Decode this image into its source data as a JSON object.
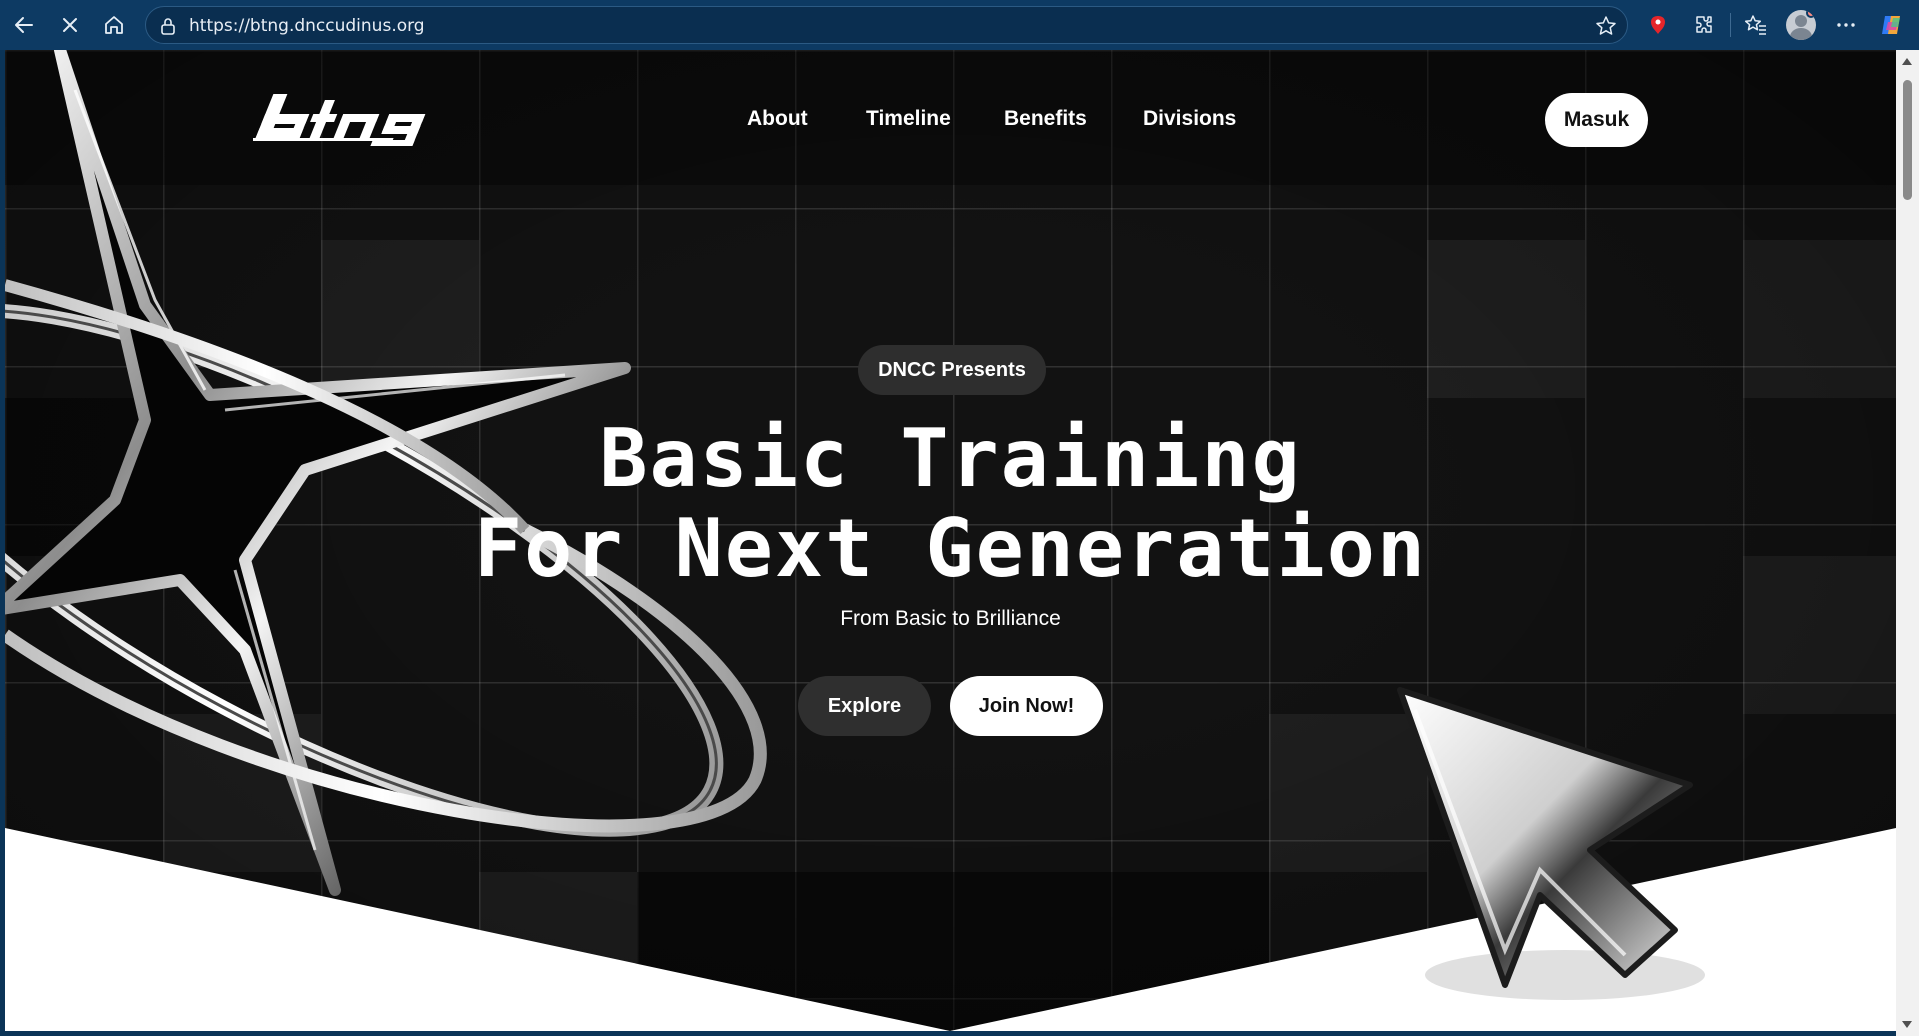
{
  "browser": {
    "url": "https://btng.dnccudinus.org",
    "icons": [
      "back-arrow-icon",
      "stop-loading-icon",
      "home-icon",
      "lock-icon",
      "favorite-star-icon",
      "extension-icon",
      "extensions-puzzle-icon",
      "favorites-icon",
      "profile-avatar-icon",
      "more-menu-icon",
      "copilot-icon"
    ]
  },
  "nav": {
    "logo_text": "btng",
    "links": [
      "About",
      "Timeline",
      "Benefits",
      "Divisions"
    ],
    "login_label": "Masuk"
  },
  "hero": {
    "badge": "DNCC Presents",
    "title_line1": "Basic Training",
    "title_line2": "For Next Generation",
    "subtitle": "From Basic to Brilliance",
    "explore_label": "Explore",
    "join_label": "Join Now!"
  },
  "colors": {
    "chrome_bg": "#0d3a63",
    "page_bg": "#121212",
    "accent_white": "#ffffff",
    "button_dark": "#2f2f2f"
  }
}
